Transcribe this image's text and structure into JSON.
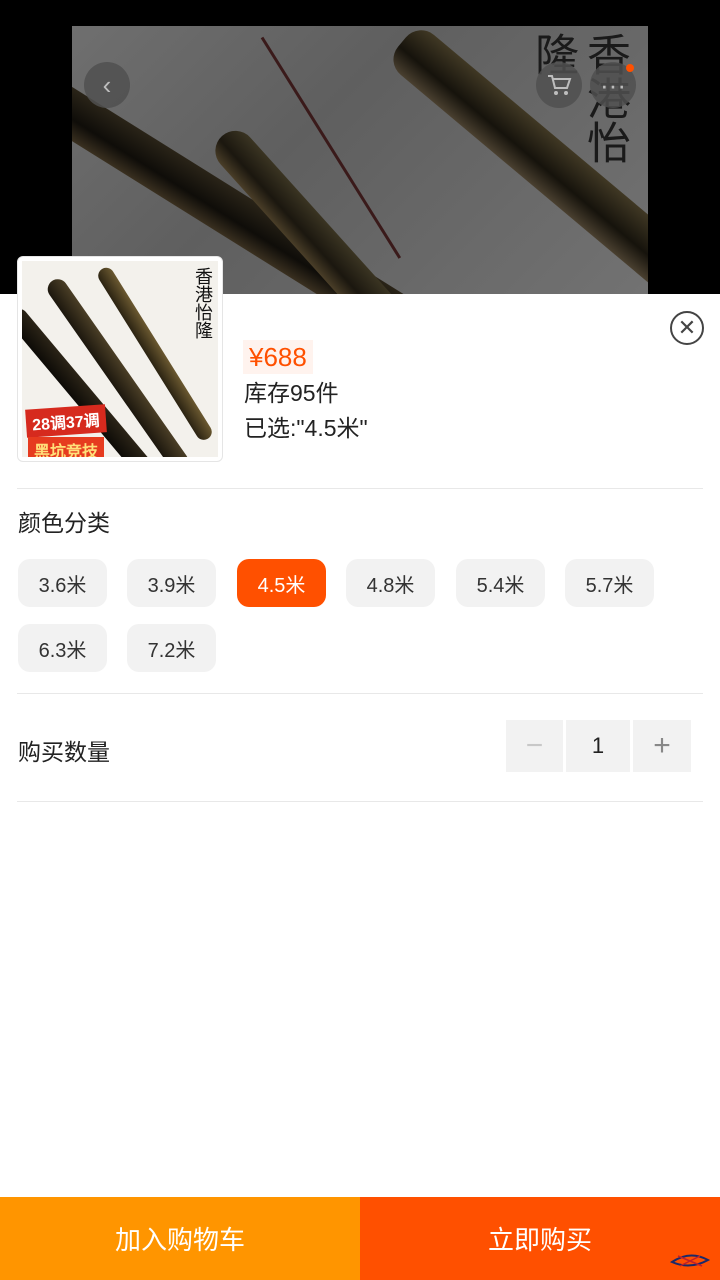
{
  "hero": {
    "brand_text": "香港怡隆",
    "back_icon": "chevron-left-icon",
    "cart_icon": "cart-icon",
    "more_icon": "more-icon"
  },
  "product": {
    "thumb_brand": "香港怡隆",
    "thumb_badge_top": "28调37调",
    "thumb_badge_bottom": "黑坑竞技",
    "price": "¥688",
    "stock": "库存95件",
    "selected": "已选:\"4.5米\""
  },
  "color_section": {
    "title": "颜色分类",
    "options": [
      "3.6米",
      "3.9米",
      "4.5米",
      "4.8米",
      "5.4米",
      "5.7米",
      "6.3米",
      "7.2米"
    ],
    "selected_index": 2
  },
  "quantity_section": {
    "title": "购买数量",
    "minus": "−",
    "value": "1",
    "plus": "+"
  },
  "actions": {
    "add_to_cart": "加入购物车",
    "buy_now": "立即购买"
  },
  "colors": {
    "accent": "#ff5000",
    "cart_button": "#ff9500",
    "chip_bg": "#f2f2f2"
  }
}
